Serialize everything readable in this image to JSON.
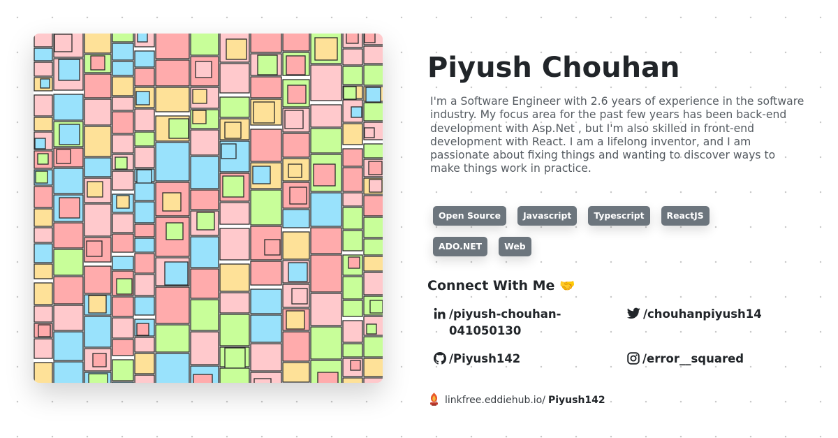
{
  "profile": {
    "name": "Piyush Chouhan",
    "bio": "I'm a Software Engineer with 2.6 years of experience in the software industry. My focus area for the past few years has been back-end development with Asp.Net , but I'm also skilled in front-end development with React. I am a lifelong inventor, and I am passionate about fixing things and wanting to discover ways to make things work in practice."
  },
  "tags": [
    "Open Source",
    "Javascript",
    "Typescript",
    "ReactJS",
    "ADO.NET",
    "Web"
  ],
  "connect": {
    "title": "Connect With Me",
    "emoji": "🤝"
  },
  "socials": {
    "linkedin": {
      "handle": "/piyush-chouhan-041050130",
      "icon": "linkedin-icon"
    },
    "twitter": {
      "handle": "/chouhanpiyush14",
      "icon": "twitter-icon"
    },
    "github": {
      "handle": "/Piyush142",
      "icon": "github-icon"
    },
    "instagram": {
      "handle": "/error__squared",
      "icon": "instagram-icon"
    }
  },
  "footer": {
    "domain": "linkfree.eddiehub.io/",
    "username": "Piyush142",
    "icon": "eddiehub-logo"
  },
  "colors": {
    "tag_bg": "#6c757d",
    "text": "#212529",
    "avatar_palette": [
      "#ffc9cc",
      "#99e2fc",
      "#fee198",
      "#c8fe99",
      "#ffabac"
    ]
  }
}
